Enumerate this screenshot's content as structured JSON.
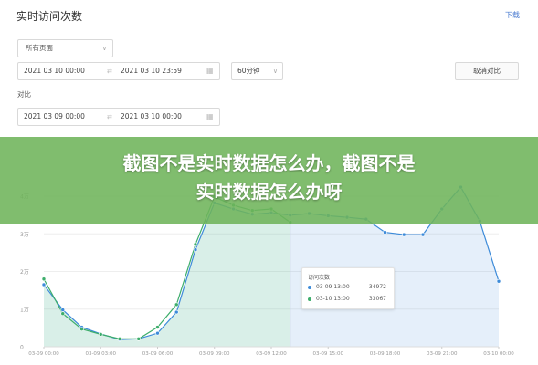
{
  "panel": {
    "title": "实时访问次数",
    "download": "下载"
  },
  "filters": {
    "page_select": "所有页面",
    "range1": {
      "start": "2021 03 10 00:00",
      "end": "2021 03 10 23:59"
    },
    "interval": "60分钟",
    "cancel_compare": "取消对比",
    "compare_label": "对比",
    "range2": {
      "start": "2021 03 09 00:00",
      "end": "2021 03 10 00:00"
    }
  },
  "overlay": {
    "line1": "截图不是实时数据怎么办，截图不是",
    "line2": "实时数据怎么办呀"
  },
  "tooltip": {
    "title": "访问次数",
    "rows": [
      {
        "time": "03-09 13:00",
        "value": "34972",
        "color": "#3d8bd9"
      },
      {
        "time": "03-10 13:00",
        "value": "33067",
        "color": "#3dad6b"
      }
    ]
  },
  "chart_data": {
    "type": "line",
    "x_tick_labels": [
      "03-09 00:00",
      "03-09 03:00",
      "03-09 06:00",
      "03-09 09:00",
      "03-09 12:00",
      "03-09 15:00",
      "03-09 18:00",
      "03-09 21:00",
      "03-10 00:00"
    ],
    "y_tick_labels": [
      "0",
      "1万",
      "2万",
      "3万",
      "4万"
    ],
    "ylim": [
      0,
      40000
    ],
    "series": [
      {
        "color": "#3d8bd9",
        "x_hours": [
          0,
          1,
          2,
          3,
          4,
          5,
          6,
          7,
          8,
          9,
          10,
          11,
          12,
          13,
          14,
          15,
          16,
          17,
          18,
          19,
          20,
          21,
          22,
          23,
          24
        ],
        "values": [
          16500,
          9800,
          5200,
          3400,
          1900,
          2100,
          3600,
          9200,
          25800,
          38200,
          36600,
          35200,
          35600,
          34972,
          35400,
          34800,
          34400,
          33900,
          30400,
          29800,
          29800,
          36600,
          42400,
          33400,
          17400
        ]
      },
      {
        "color": "#3dad6b",
        "x_hours": [
          0,
          1,
          2,
          3,
          4,
          5,
          6,
          7,
          8,
          9,
          10,
          11,
          12,
          13
        ],
        "values": [
          18000,
          8800,
          4700,
          3300,
          2100,
          2100,
          5200,
          11200,
          27200,
          39800,
          37600,
          36200,
          36600,
          33067
        ]
      }
    ]
  }
}
